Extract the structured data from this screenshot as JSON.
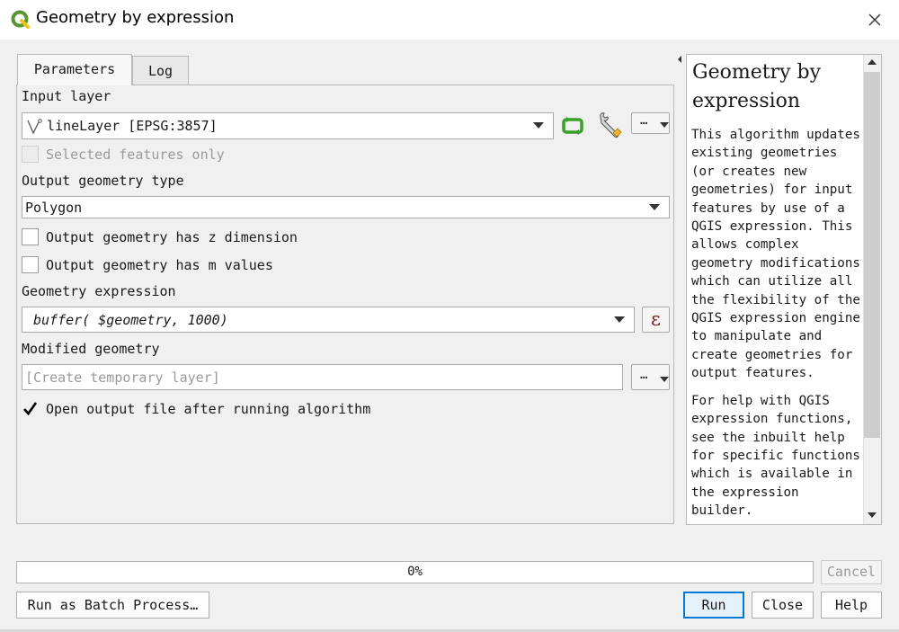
{
  "window": {
    "title": "Geometry by expression",
    "close_icon": "close-x-icon",
    "app_icon": "qgis-logo-icon",
    "brand_color": "#589632"
  },
  "tabs": [
    {
      "label": "Parameters",
      "active": true
    },
    {
      "label": "Log",
      "active": false
    }
  ],
  "params": {
    "input_layer_label": "Input layer",
    "input_layer_value": "lineLayer [EPSG:3857]",
    "selected_only_label": "Selected features only",
    "output_type_label": "Output geometry type",
    "output_type_value": "Polygon",
    "has_z_label": "Output geometry has z dimension",
    "has_m_label": "Output geometry has m values",
    "expression_label": "Geometry expression",
    "expression_value": "buffer( $geometry, 1000)",
    "expression_button_glyph": "ε",
    "modified_label": "Modified geometry",
    "modified_placeholder": "[Create temporary layer]",
    "open_output_label": "Open output file after running algorithm",
    "open_output_checked": true,
    "more_button_label": "…"
  },
  "help": {
    "title": "Geometry by expression",
    "body_1": "This algorithm updates existing geometries (or creates new geometries) for input features by use of a QGIS expression. This allows complex geometry modifications which can utilize all the flexibility of the QGIS expression engine to manipulate and create geometries for output features.",
    "body_2": "For help with QGIS expression functions, see the inbuilt help for specific functions which is available in the expression builder."
  },
  "progress": {
    "text": "0%",
    "value": 0
  },
  "buttons": {
    "cancel": "Cancel",
    "batch": "Run as Batch Process…",
    "run": "Run",
    "close": "Close",
    "help": "Help"
  }
}
